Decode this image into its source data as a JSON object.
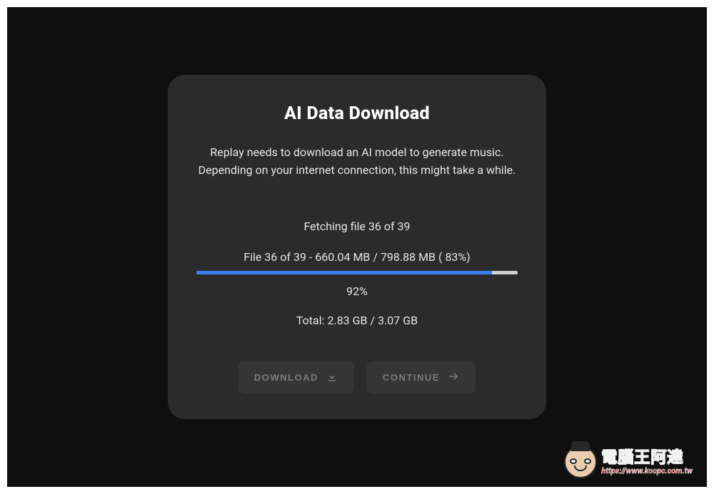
{
  "dialog": {
    "title": "AI Data Download",
    "description": "Replay needs to download an AI model to generate music. Depending on your internet connection, this might take a while.",
    "fetching": "Fetching file 36 of 39",
    "file_progress": "File 36 of 39 - 660.04 MB / 798.88 MB ( 83%)",
    "overall_percent": "92%",
    "overall_percent_value": 92,
    "total": "Total: 2.83 GB / 3.07 GB",
    "buttons": {
      "download": "DOWNLOAD",
      "continue": "CONTINUE"
    }
  },
  "watermark": {
    "main": "電腦王阿達",
    "sub": "https://www.kocpc.com.tw"
  }
}
